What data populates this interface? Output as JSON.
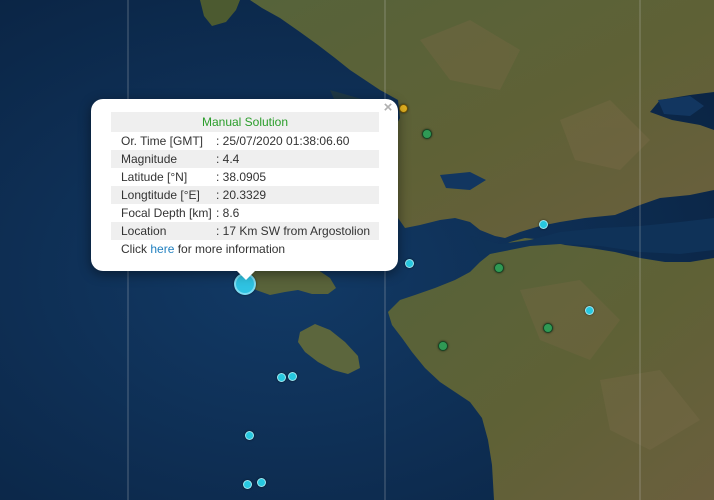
{
  "popup": {
    "title": "Manual Solution",
    "rows": [
      {
        "label": "Or. Time [GMT]",
        "value": ": 25/07/2020 01:38:06.60"
      },
      {
        "label": "Magnitude",
        "value": ": 4.4"
      },
      {
        "label": "Latitude [°N]",
        "value": ": 38.0905"
      },
      {
        "label": "Longtitude [°E]",
        "value": ": 20.3329"
      },
      {
        "label": "Focal Depth [km]",
        "value": ": 8.6"
      },
      {
        "label": "Location",
        "value": ": 17 Km SW from Argostolion"
      }
    ],
    "footer_prefix": "Click ",
    "footer_link": "here",
    "footer_suffix": " for more information",
    "close_icon": "×"
  },
  "colors": {
    "sea": "#0d2a4c",
    "land": "#4c5a30",
    "marker_cyan": "#27c8e0",
    "marker_green": "#2f9a55",
    "marker_yellow": "#e0b020",
    "title_green": "#2a9d2a",
    "link_blue": "#1f7fbf"
  }
}
